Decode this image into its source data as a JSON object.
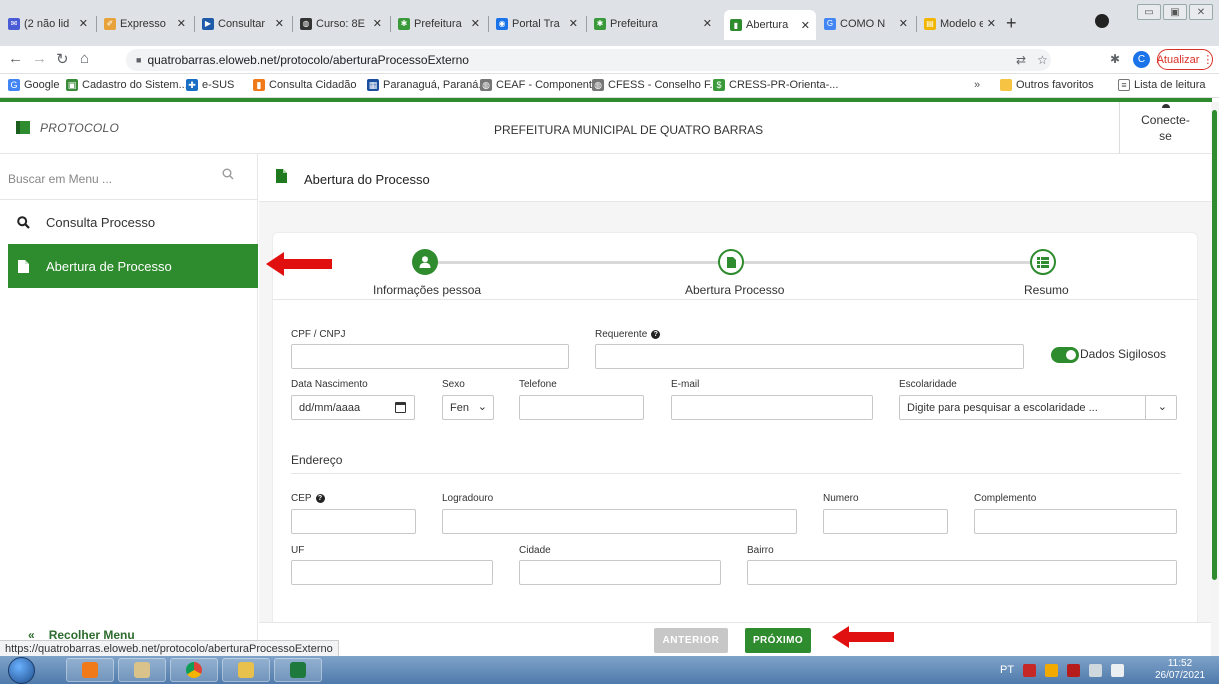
{
  "browser": {
    "tabs": [
      {
        "title": "(2 não lid",
        "color": "#4a5bd6",
        "glyph": "✉"
      },
      {
        "title": "Expresso",
        "color": "#e8a23a",
        "glyph": "✐"
      },
      {
        "title": "Consultar",
        "color": "#1e5aa8",
        "glyph": "▶"
      },
      {
        "title": "Curso: 8E",
        "color": "#333333",
        "glyph": "◍"
      },
      {
        "title": "Prefeitura",
        "color": "#3a9a3a",
        "glyph": "✱"
      },
      {
        "title": "Portal Tra",
        "color": "#1a73e8",
        "glyph": "◉"
      },
      {
        "title": "Prefeitura",
        "color": "#3a9a3a",
        "glyph": "✱"
      },
      {
        "title": "Abertura",
        "color": "#2e8b2e",
        "glyph": "▮"
      },
      {
        "title": "COMO N",
        "color": "#4285f4",
        "glyph": "G"
      },
      {
        "title": "Modelo e",
        "color": "#f2b600",
        "glyph": "▤"
      }
    ],
    "url": "quatrobarras.eloweb.net/protocolo/aberturaProcessoExterno",
    "profile_initial": "C",
    "update_label": "Atualizar",
    "bookmarks": [
      {
        "label": "Google",
        "color": "#4285f4",
        "glyph": "G"
      },
      {
        "label": "Cadastro do Sistem...",
        "color": "#3a8a3a",
        "glyph": "▣"
      },
      {
        "label": "e-SUS",
        "color": "#1a6fc4",
        "glyph": "✚"
      },
      {
        "label": "Consulta Cidadão",
        "color": "#f07a1a",
        "glyph": "▮"
      },
      {
        "label": "Paranaguá, Paraná...",
        "color": "#1a4fa0",
        "glyph": "▦"
      },
      {
        "label": "CEAF - Component...",
        "color": "#777777",
        "glyph": "◍"
      },
      {
        "label": "CFESS - Conselho F...",
        "color": "#777777",
        "glyph": "◍"
      },
      {
        "label": "CRESS-PR-Orienta-...",
        "color": "#3a9a3a",
        "glyph": "$"
      }
    ],
    "bookmarks_more": "»",
    "other_favorites": "Outros favoritos",
    "reading_list": "Lista de leitura",
    "status_url": "https://quatrobarras.eloweb.net/protocolo/aberturaProcessoExterno"
  },
  "app": {
    "name": "PROTOCOLO",
    "org": "PREFEITURA MUNICIPAL DE QUATRO BARRAS",
    "connect_label_1": "Conecte-",
    "connect_label_2": "se"
  },
  "sidebar": {
    "search_placeholder": "Buscar em Menu ...",
    "items": [
      {
        "label": "Consulta Processo"
      },
      {
        "label": "Abertura de Processo"
      }
    ],
    "collapse_label": "Recolher Menu"
  },
  "main": {
    "title": "Abertura do Processo",
    "steps": [
      {
        "label": "Informações pessoa"
      },
      {
        "label": "Abertura Processo"
      },
      {
        "label": "Resumo"
      }
    ],
    "form": {
      "cpf_label": "CPF / CNPJ",
      "requerente_label": "Requerente",
      "sigilo_label": "Dados Sigilosos",
      "nasc_label": "Data Nascimento",
      "nasc_value": "dd/mm/aaaa",
      "sexo_label": "Sexo",
      "sexo_value": "Fen",
      "telefone_label": "Telefone",
      "email_label": "E-mail",
      "escolaridade_label": "Escolaridade",
      "escolaridade_placeholder": "Digite para pesquisar a escolaridade ...",
      "endereco_title": "Endereço",
      "cep_label": "CEP",
      "logradouro_label": "Logradouro",
      "numero_label": "Numero",
      "complemento_label": "Complemento",
      "uf_label": "UF",
      "cidade_label": "Cidade",
      "bairro_label": "Bairro"
    },
    "prev_label": "ANTERIOR",
    "next_label": "PRÓXIMO"
  },
  "taskbar": {
    "lang": "PT",
    "time": "11:52",
    "date": "26/07/2021"
  },
  "colors": {
    "brand_green": "#2e8b2e",
    "annotation_red": "#e01010"
  }
}
